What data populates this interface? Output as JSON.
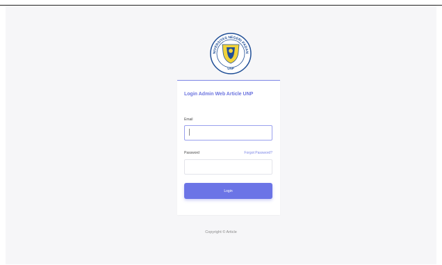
{
  "logo": {
    "icon": "university-seal-icon",
    "text_top": "UNIVERSITAS NEGERI PADANG",
    "text_bottom": "UNP",
    "colors": {
      "ring": "#1f4e96",
      "inner": "#f1d33a",
      "blue": "#1f4e96"
    }
  },
  "login": {
    "title": "Login Admin Web Article UNP",
    "email_label": "Email",
    "email_value": "",
    "password_label": "Password",
    "password_value": "",
    "forgot_label": "Forgot Password?",
    "button_label": "Login"
  },
  "footer": {
    "copyright": "Copyright © Article"
  },
  "theme": {
    "accent": "#6b74e6",
    "background": "#f6f6f8"
  }
}
